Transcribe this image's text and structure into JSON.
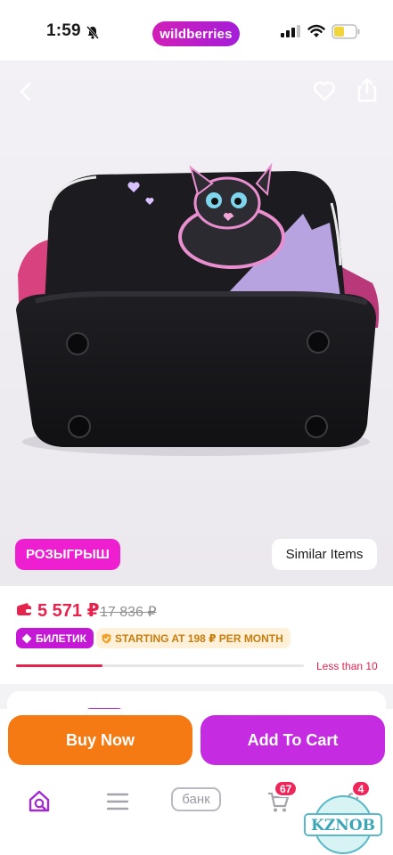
{
  "status_bar": {
    "time": "1:59",
    "brand": "wildberries"
  },
  "gallery": {
    "back_icon": "chevron-left-icon",
    "favorite_icon": "heart-outline-icon",
    "share_icon": "share-icon",
    "image_subject": "black backpack bottom view with cat print",
    "promo_badge": "РОЗЫГРЫШ",
    "similar_button": "Similar Items"
  },
  "price": {
    "current": "5 571 ₽",
    "old": "17 836 ₽",
    "ticket_badge": "БИЛЕТИК",
    "installment": "STARTING AT 198 ₽ PER MONTH",
    "stock_text": "Less than 10",
    "stock_level": 0.3
  },
  "actions": {
    "buy_now": "Buy Now",
    "add_to_cart": "Add To Cart"
  },
  "tab_bar": {
    "items": [
      {
        "icon": "home-search-icon"
      },
      {
        "icon": "menu-icon"
      },
      {
        "label": "банк"
      },
      {
        "icon": "cart-icon",
        "badge": "67"
      },
      {
        "icon": "profile-icon",
        "badge": "4"
      }
    ]
  },
  "watermark": "KZNOB",
  "colors": {
    "brand_gradient_start": "#d21fb8",
    "brand_gradient_end": "#a41ed9",
    "promo": "#ee1fd0",
    "price_red": "#e5244e",
    "buy_now": "#f57a14",
    "add_to_cart": "#c52be0",
    "badge_red": "#f0265b"
  }
}
